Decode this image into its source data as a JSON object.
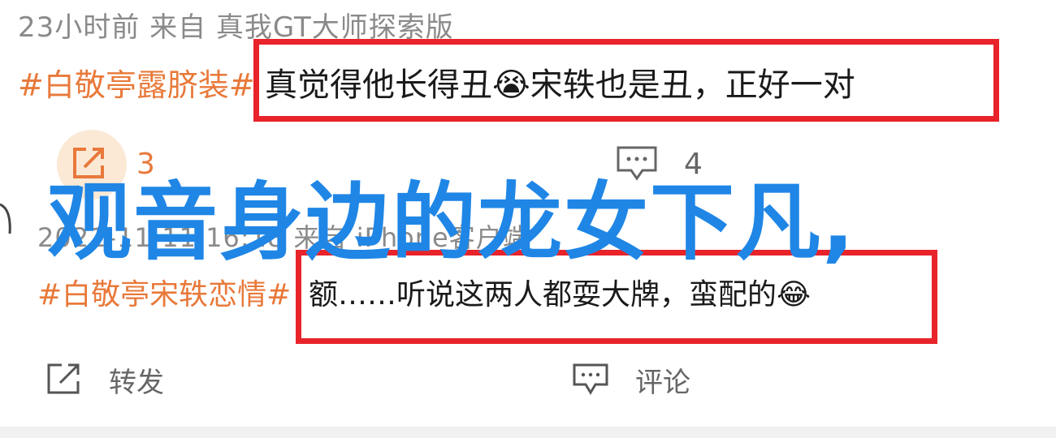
{
  "post1": {
    "meta": "23小时前 来自 真我GT大师探索版",
    "tag": "#白敬亭露脐装#",
    "text": "真觉得他长得丑😭宋轶也是丑，正好一对",
    "share_count": "3",
    "comment_count": "4"
  },
  "headline": "观音身边的龙女下凡,",
  "post2": {
    "meta": "2021-11-11 16:18 来自 iPhone客户端",
    "tag": "#白敬亭宋轶恋情#",
    "text": "额……听说这两人都耍大牌，蛮配的😂"
  },
  "actions": {
    "share_label": "转发",
    "comment_label": "评论"
  },
  "colors": {
    "accent": "#e8793a",
    "highlight_box": "#e8232a",
    "headline": "#1f86e6"
  }
}
